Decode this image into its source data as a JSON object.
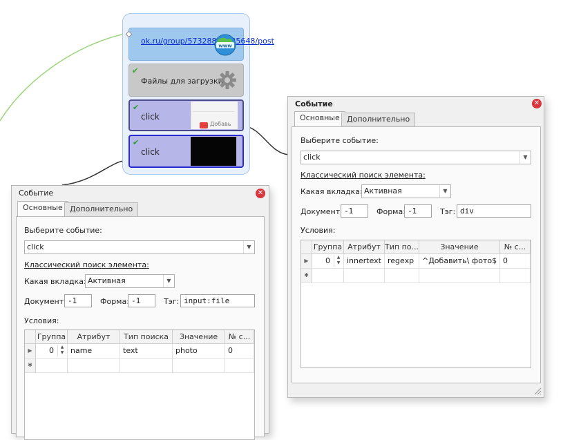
{
  "canvas": {
    "url_node_text": "ok.ru/group/57328848535648/post",
    "files_node_label": "Файлы для загрузки",
    "click1_label": "click",
    "click2_label": "click",
    "click1_thumb_text": "Добавь"
  },
  "dialog_left": {
    "title": "Событие",
    "tabs": [
      "Основные",
      "Дополнительно"
    ],
    "event_label": "Выберите событие:",
    "event_value": "click",
    "classic_search": "Классический поиск элемента:",
    "tab_label": "Какая вкладка:",
    "tab_value": "Активная",
    "doc_label": "Документ:",
    "doc_value": "-1",
    "form_label": "Форма:",
    "form_value": "-1",
    "tag_label": "Тэг:",
    "tag_value": "input:file",
    "conditions_label": "Условия:",
    "columns": [
      "Группа",
      "Атрибут",
      "Тип поиска",
      "Значение",
      "№ с..."
    ],
    "rows": [
      {
        "group": "0",
        "attr": "name",
        "type": "text",
        "value": "photo",
        "num": "0"
      }
    ]
  },
  "dialog_right": {
    "title": "Событие",
    "tabs": [
      "Основные",
      "Дополнительно"
    ],
    "event_label": "Выберите событие:",
    "event_value": "click",
    "classic_search": "Классический поиск элемента:",
    "tab_label": "Какая вкладка:",
    "tab_value": "Активная",
    "doc_label": "Документ:",
    "doc_value": "-1",
    "form_label": "Форма:",
    "form_value": "-1",
    "tag_label": "Тэг:",
    "tag_value": "div",
    "conditions_label": "Условия:",
    "columns": [
      "Группа",
      "Атрибут",
      "Тип по...",
      "Значение",
      "№ с..."
    ],
    "rows": [
      {
        "group": "0",
        "attr": "innertext",
        "type": "regexp",
        "value": "^Добавить\\ фото$",
        "num": "0"
      }
    ]
  },
  "colors": {
    "url_node": "#9ec8ee",
    "files_node": "#c8c8c8",
    "click_node": "#b7b6e8",
    "close_button": "#d9363e",
    "connector_green": "#9bd67a"
  }
}
